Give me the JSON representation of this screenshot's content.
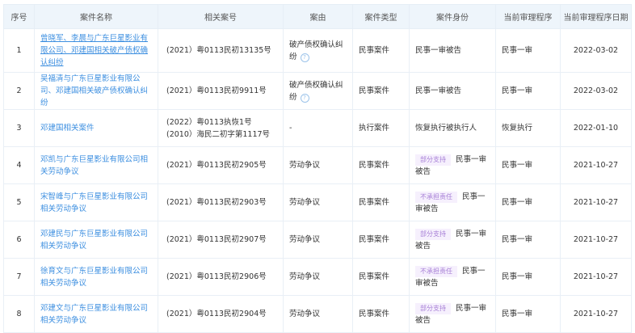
{
  "headers": [
    "序号",
    "案件名称",
    "相关案号",
    "案由",
    "案件类型",
    "案件身份",
    "当前审理程序",
    "当前审理程序日期"
  ],
  "rows": [
    {
      "no": "1",
      "name": "曾晓军、李晨与广东巨星影业有限公司、邓建国相关破产债权确认纠纷",
      "case_nos": [
        "(2021）粤0113民初13135号"
      ],
      "cause": "破产债权确认纠纷",
      "help": "?",
      "type": "民事案件",
      "tag": "",
      "role": "民事一审被告",
      "stage": "民事一审",
      "date": "2022-03-02"
    },
    {
      "no": "2",
      "name": "吴福清与广东巨星影业有限公司、邓建国相关破产债权确认纠纷",
      "case_nos": [
        "(2021）粤0113民初9911号"
      ],
      "cause": "破产债权确认纠纷",
      "help": "?",
      "type": "民事案件",
      "tag": "",
      "role": "民事一审被告",
      "stage": "民事一审",
      "date": "2022-03-02"
    },
    {
      "no": "3",
      "name": "邓建国相关案件",
      "case_nos": [
        "(2022）粤0113执恢1号",
        "(2010）海民二初字第1117号"
      ],
      "cause": "-",
      "type": "执行案件",
      "tag": "",
      "role": "恢复执行被执行人",
      "stage": "恢复执行",
      "date": "2022-01-10"
    },
    {
      "no": "4",
      "name": "邓凯与广东巨星影业有限公司相关劳动争议",
      "case_nos": [
        "(2021）粤0113民初2905号"
      ],
      "cause": "劳动争议",
      "type": "民事案件",
      "tag": "部分支持",
      "role": "民事一审被告",
      "stage": "民事一审",
      "date": "2021-10-27"
    },
    {
      "no": "5",
      "name": "宋智峰与广东巨星影业有限公司相关劳动争议",
      "case_nos": [
        "(2021）粤0113民初2903号"
      ],
      "cause": "劳动争议",
      "type": "民事案件",
      "tag": "不承担责任",
      "role": "民事一审被告",
      "stage": "民事一审",
      "date": "2021-10-27"
    },
    {
      "no": "6",
      "name": "邓建民与广东巨星影业有限公司相关劳动争议",
      "case_nos": [
        "(2021）粤0113民初2907号"
      ],
      "cause": "劳动争议",
      "type": "民事案件",
      "tag": "部分支持",
      "role": "民事一审被告",
      "stage": "民事一审",
      "date": "2021-10-27"
    },
    {
      "no": "7",
      "name": "徐育文与广东巨星影业有限公司相关劳动争议",
      "case_nos": [
        "(2021）粤0113民初2906号"
      ],
      "cause": "劳动争议",
      "type": "民事案件",
      "tag": "不承担责任",
      "role": "民事一审被告",
      "stage": "民事一审",
      "date": "2021-10-27"
    },
    {
      "no": "8",
      "name": "邓建文与广东巨星影业有限公司相关劳动争议",
      "case_nos": [
        "(2021）粤0113民初2904号"
      ],
      "cause": "劳动争议",
      "type": "民事案件",
      "tag": "部分支持",
      "role": "民事一审被告",
      "stage": "民事一审",
      "date": "2021-10-27"
    }
  ]
}
